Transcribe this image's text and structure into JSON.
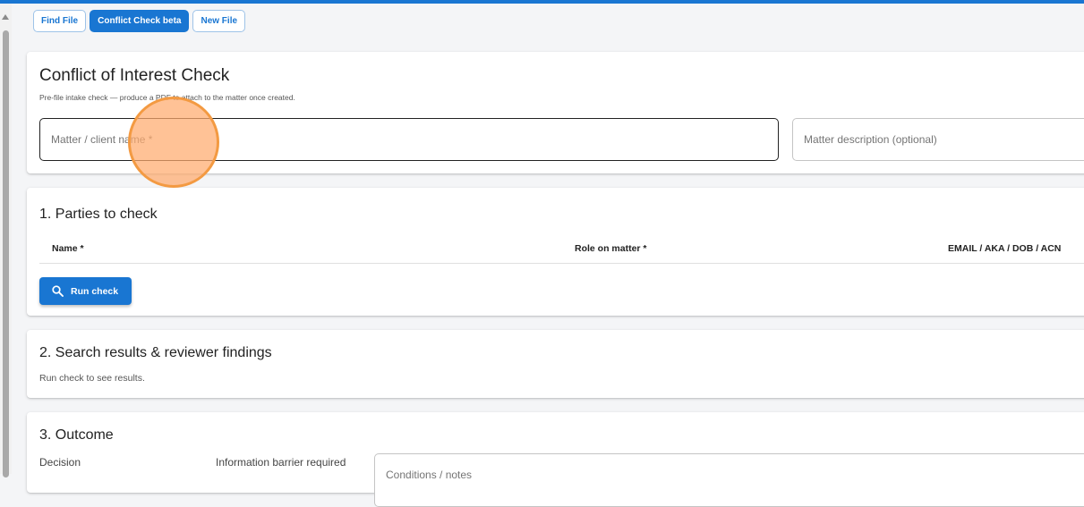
{
  "tabs": [
    {
      "label": "Find File",
      "active": false
    },
    {
      "label": "Conflict Check beta",
      "active": true
    },
    {
      "label": "New File",
      "active": false
    }
  ],
  "header": {
    "title": "Conflict of Interest Check",
    "subtitle": "Pre-file intake check — produce a PDF to attach to the matter once created.",
    "matter_name_placeholder": "Matter / client name *",
    "matter_description_placeholder": "Matter description (optional)"
  },
  "parties": {
    "title": "1. Parties to check",
    "columns": [
      "Name *",
      "Role on matter *",
      "EMAIL / AKA / DOB / ACN"
    ],
    "run_check_label": "Run check"
  },
  "results": {
    "title": "2. Search results & reviewer findings",
    "empty_text": "Run check to see results."
  },
  "outcome": {
    "title": "3. Outcome",
    "decision_label": "Decision",
    "barrier_label": "Information barrier required",
    "conditions_placeholder": "Conditions / notes"
  },
  "colors": {
    "accent": "#1976d2",
    "cursor_highlight": "#f39a42"
  }
}
